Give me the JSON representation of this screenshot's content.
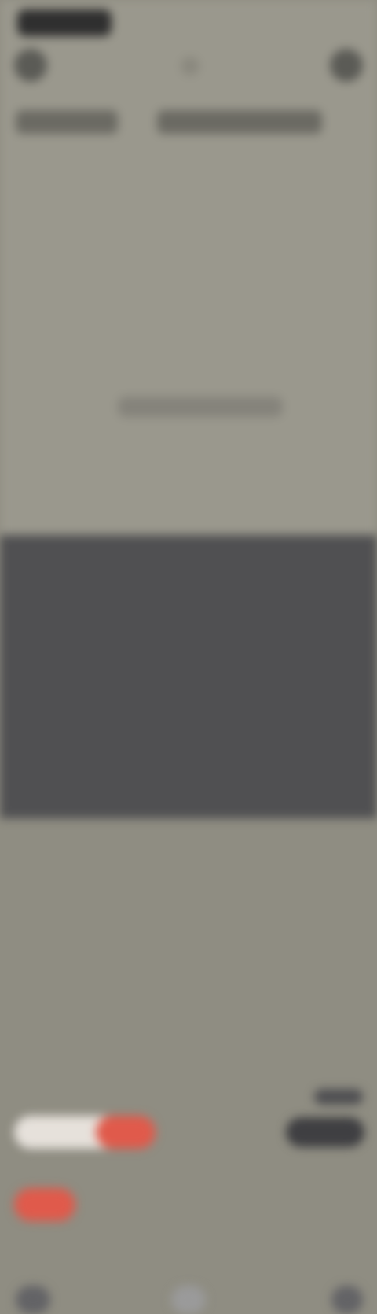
{
  "status": {
    "time": ""
  },
  "header": {
    "left_icon": "circle-icon",
    "right_icon": "circle-icon"
  },
  "content": {
    "headline_a": "",
    "headline_b": "",
    "center_text": ""
  },
  "controls": {
    "slider_level": 0.58,
    "right_badge_text": "",
    "small_pill_label": ""
  },
  "nav": {
    "left_icon": "nav-left-icon",
    "center_icon": "nav-center-icon",
    "right_icon": "nav-right-icon"
  },
  "colors": {
    "top_bg": "#9a988d",
    "bottom_bg": "#505052",
    "accent": "#e05a4b",
    "slider_track": "#e6e1db"
  }
}
